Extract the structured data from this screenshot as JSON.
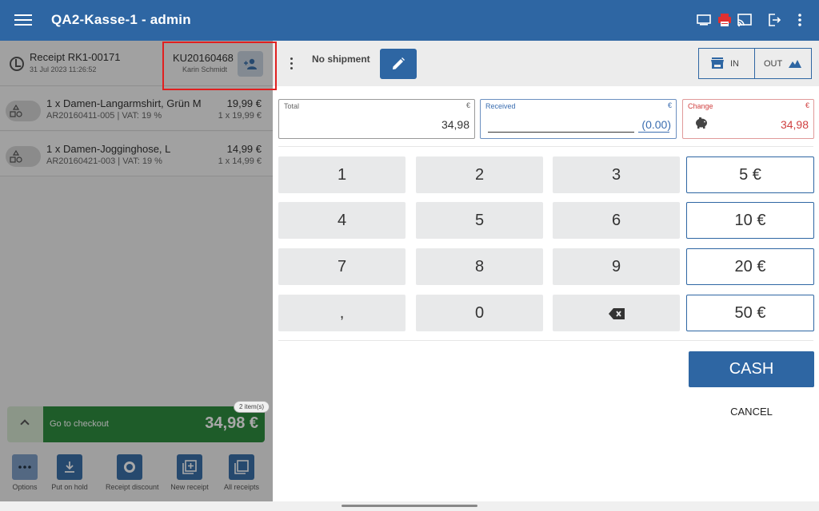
{
  "app": {
    "title": "QA2-Kasse-1 - admin",
    "accent_color": "#2e66a3",
    "printer_color": "#e03030"
  },
  "topbar": {
    "icons": [
      "menu-icon",
      "display-icon",
      "printer-icon",
      "cast-icon",
      "logout-icon",
      "more-vert-icon"
    ]
  },
  "receipt": {
    "title": "Receipt RK1-00171",
    "date": "31 Jul 2023 11:26:52",
    "customer_id": "KU20160468",
    "customer_name": "Karin Schmidt"
  },
  "items": [
    {
      "name": "1 x Damen-Langarmshirt, Grün M",
      "sku": "AR20160411-005 | VAT: 19 %",
      "price": "19,99 €",
      "qty": "1 x 19,99 €"
    },
    {
      "name": "1 x Damen-Jogginghose, L",
      "sku": "AR20160421-003 | VAT: 19 %",
      "price": "14,99 €",
      "qty": "1 x 14,99 €"
    }
  ],
  "checkout": {
    "label": "Go to checkout",
    "total": "34,98 €",
    "badge": "2 item(s)"
  },
  "bottom_actions": [
    {
      "label": "Options"
    },
    {
      "label": "Put on hold"
    },
    {
      "label": "Receipt discount"
    },
    {
      "label": "New receipt"
    },
    {
      "label": "All receipts"
    }
  ],
  "shipment": {
    "label": "No shipment",
    "in_label": "IN",
    "out_label": "OUT"
  },
  "fields": {
    "total_label": "Total",
    "total_value": "34,98",
    "received_label": "Received",
    "received_value": "(0.00)",
    "change_label": "Change",
    "change_value": "34,98",
    "currency": "€"
  },
  "keypad": {
    "keys": [
      "1",
      "2",
      "3",
      "4",
      "5",
      "6",
      "7",
      "8",
      "9",
      ",",
      "0"
    ],
    "backspace": "backspace-icon",
    "cash_amounts": [
      "5 €",
      "10 €",
      "20 €",
      "50 €"
    ]
  },
  "actions": {
    "cash": "CASH",
    "cancel": "CANCEL"
  }
}
